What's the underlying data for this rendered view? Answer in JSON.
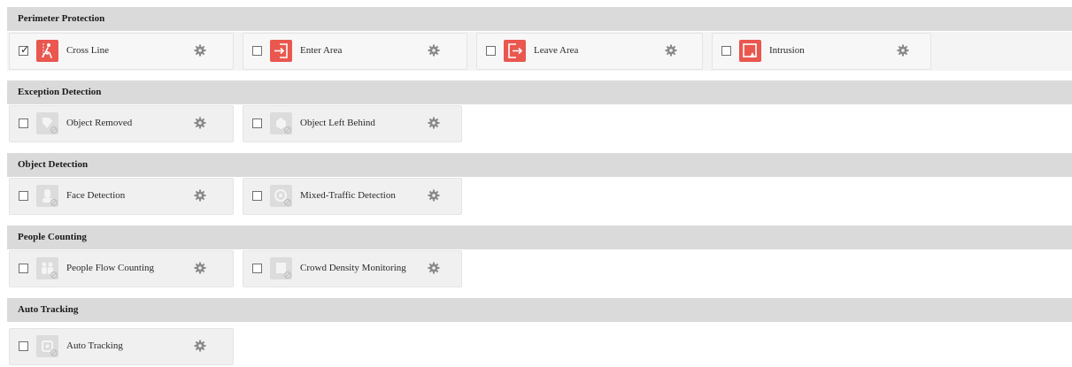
{
  "sections": [
    {
      "title": "Perimeter Protection",
      "items": [
        {
          "label": "Cross Line",
          "checked": true,
          "enabled": true,
          "icon": "cross-line-icon"
        },
        {
          "label": "Enter Area",
          "checked": false,
          "enabled": true,
          "icon": "enter-area-icon"
        },
        {
          "label": "Leave Area",
          "checked": false,
          "enabled": true,
          "icon": "leave-area-icon"
        },
        {
          "label": "Intrusion",
          "checked": false,
          "enabled": true,
          "icon": "intrusion-icon"
        }
      ]
    },
    {
      "title": "Exception Detection",
      "items": [
        {
          "label": "Object Removed",
          "checked": false,
          "enabled": false,
          "icon": "object-removed-icon"
        },
        {
          "label": "Object Left Behind",
          "checked": false,
          "enabled": false,
          "icon": "object-left-behind-icon"
        }
      ]
    },
    {
      "title": "Object Detection",
      "items": [
        {
          "label": "Face Detection",
          "checked": false,
          "enabled": false,
          "icon": "face-detection-icon"
        },
        {
          "label": "Mixed-Traffic Detection",
          "checked": false,
          "enabled": false,
          "icon": "mixed-traffic-detection-icon"
        }
      ]
    },
    {
      "title": "People Counting",
      "items": [
        {
          "label": "People Flow Counting",
          "checked": false,
          "enabled": false,
          "icon": "people-flow-counting-icon"
        },
        {
          "label": "Crowd Density Monitoring",
          "checked": false,
          "enabled": false,
          "icon": "crowd-density-monitoring-icon"
        }
      ]
    },
    {
      "title": "Auto Tracking",
      "items": [
        {
          "label": "Auto Tracking",
          "checked": false,
          "enabled": false,
          "icon": "auto-tracking-icon"
        }
      ]
    }
  ],
  "colors": {
    "accent": "#e9574f",
    "disabled_icon": "#dcdcdc",
    "section_header": "#dadada",
    "gear": "#8a8a8a"
  }
}
